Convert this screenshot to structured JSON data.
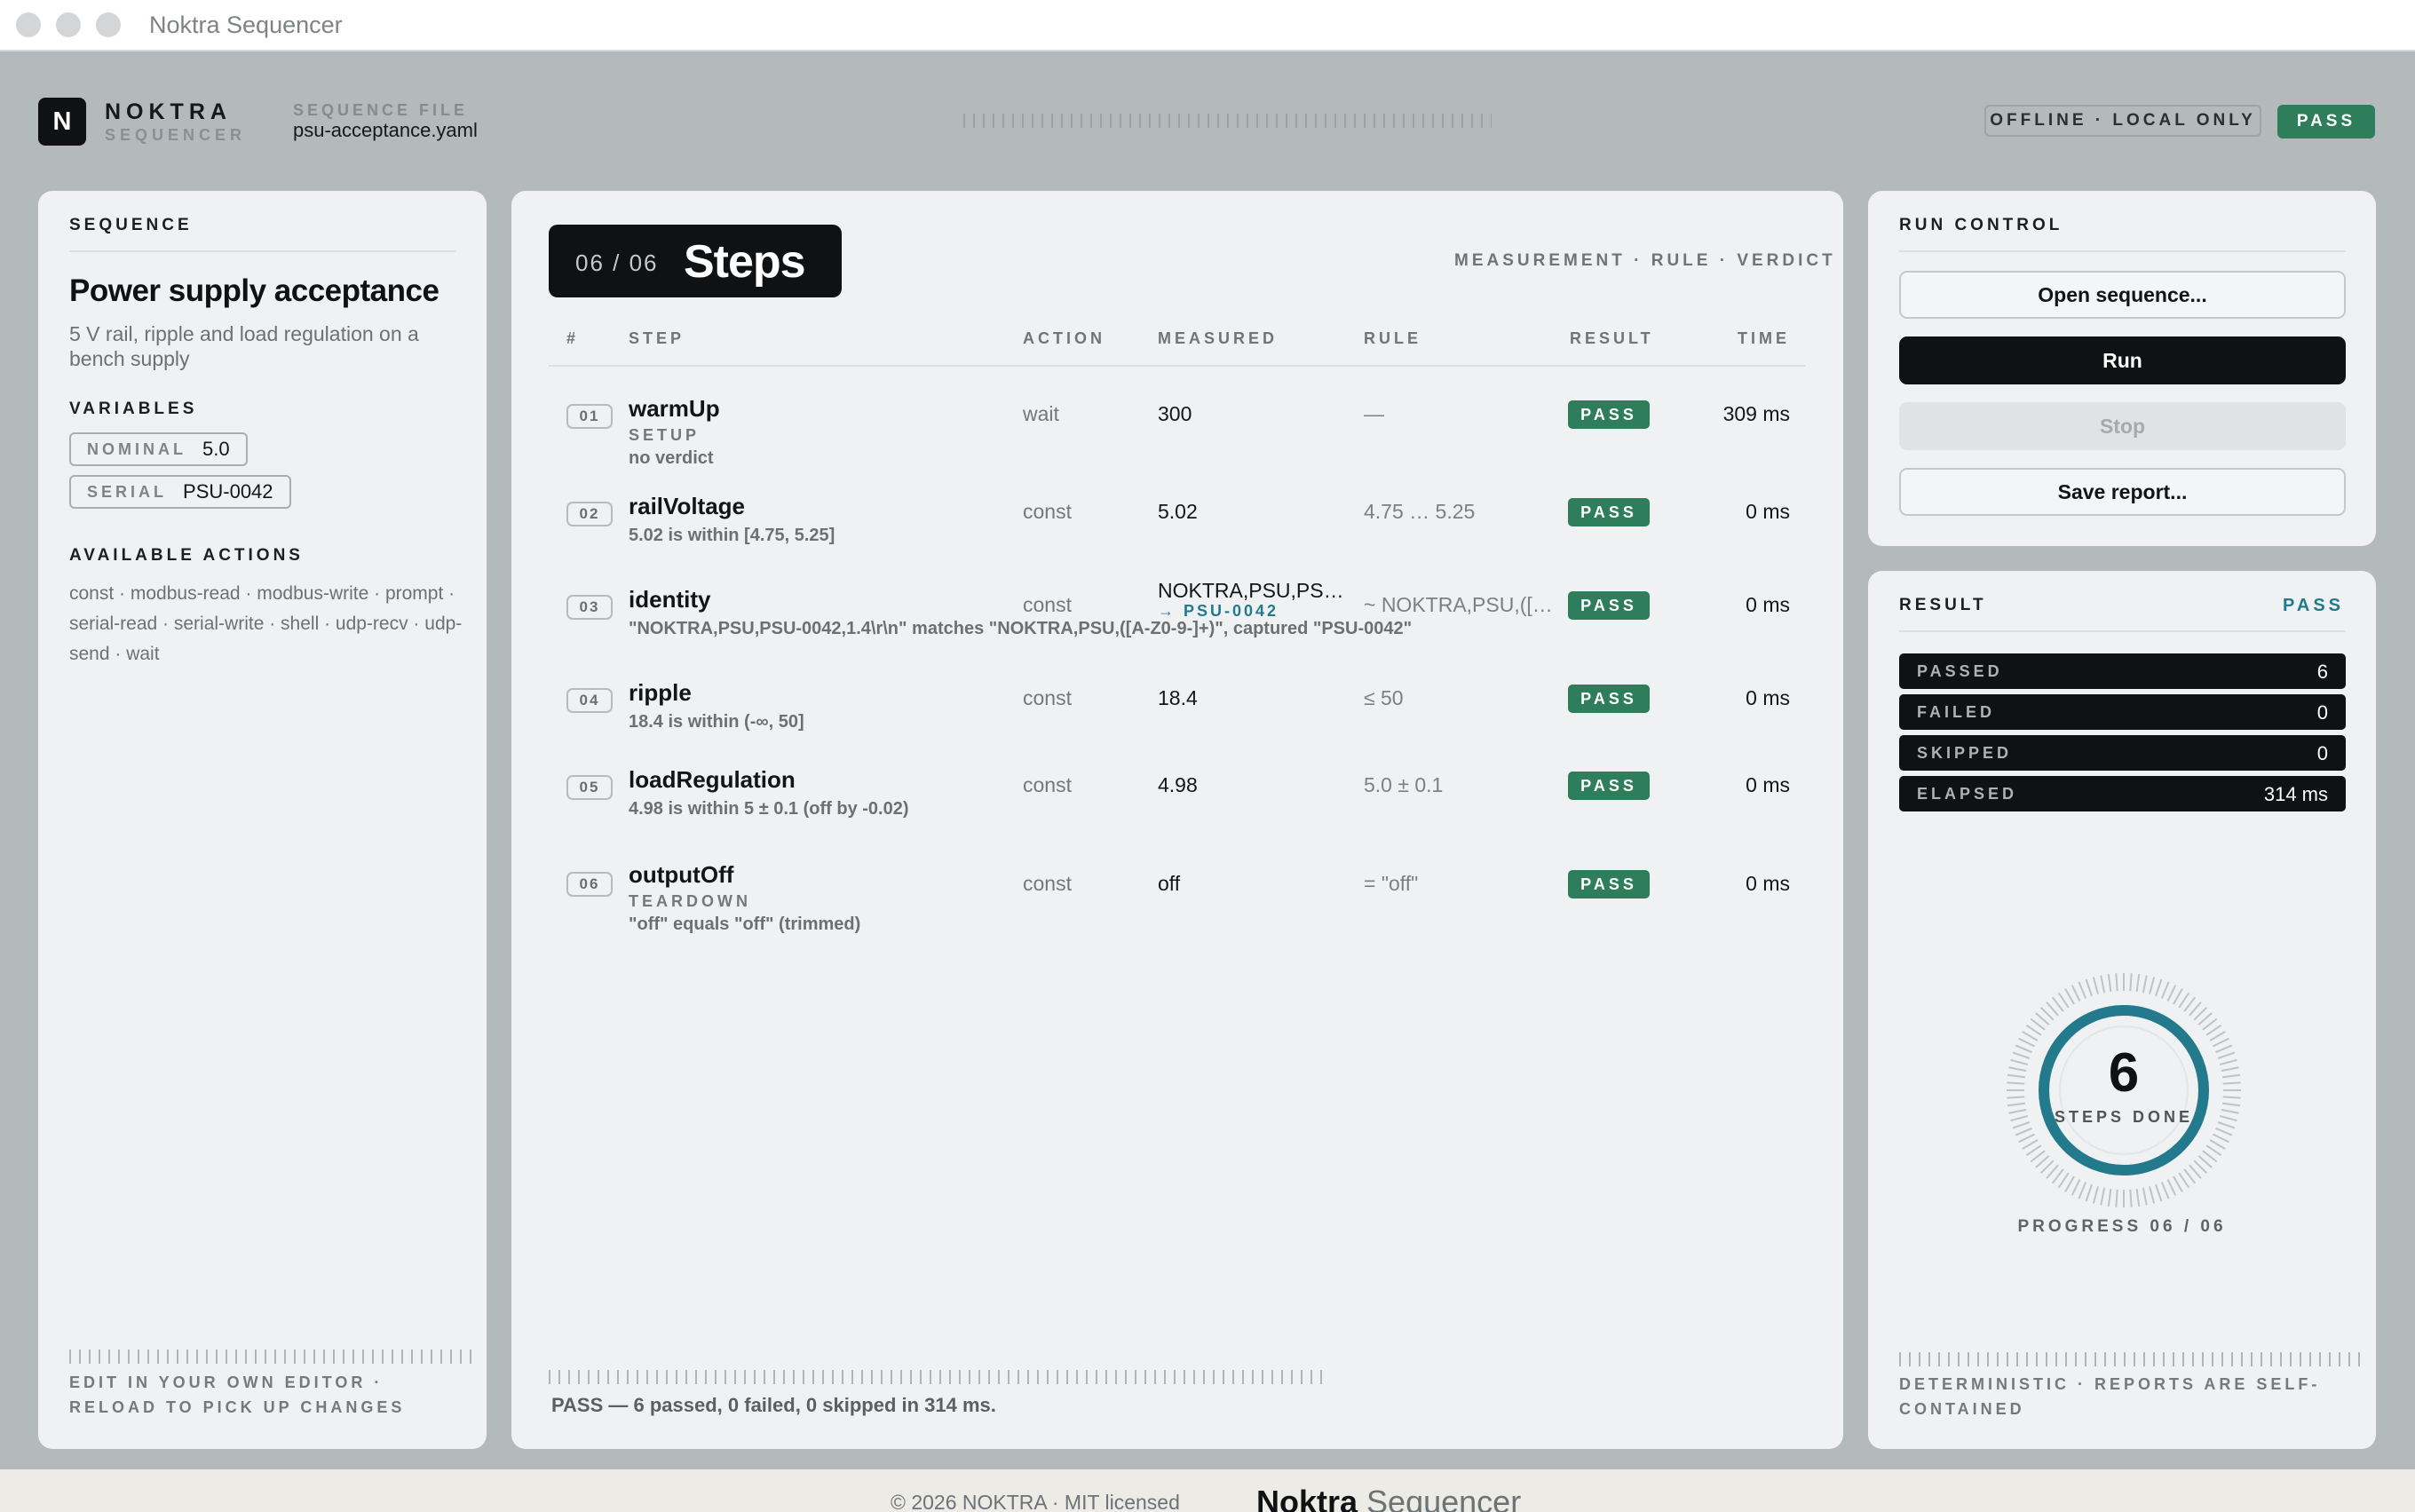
{
  "window": {
    "title": "Noktra Sequencer"
  },
  "header": {
    "logo_letter": "N",
    "brand": "NOKTRA",
    "brand_sub": "SEQUENCER",
    "sequence_file_label": "SEQUENCE FILE",
    "sequence_file": "psu-acceptance.yaml",
    "offline_badge": "OFFLINE · LOCAL ONLY",
    "status_badge": "PASS"
  },
  "sequence": {
    "section_label": "SEQUENCE",
    "title": "Power supply acceptance",
    "description": "5 V rail, ripple and load regulation on a bench supply",
    "variables_label": "VARIABLES",
    "variables": [
      {
        "key": "NOMINAL",
        "value": "5.0"
      },
      {
        "key": "SERIAL",
        "value": "PSU-0042"
      }
    ],
    "actions_label": "AVAILABLE ACTIONS",
    "actions_text": "const · modbus-read · modbus-write · prompt · serial-read · serial-write · shell · udp-recv · udp-send · wait",
    "footer_line1": "EDIT IN YOUR OWN EDITOR ·",
    "footer_line2": "RELOAD TO PICK UP CHANGES"
  },
  "steps_panel": {
    "count": "06 / 06",
    "title": "Steps",
    "subtitle": "MEASUREMENT · RULE · VERDICT",
    "columns": [
      "#",
      "STEP",
      "ACTION",
      "MEASURED",
      "RULE",
      "RESULT",
      "TIME"
    ],
    "steps": [
      {
        "num": "01",
        "name": "warmUp",
        "tag": "SETUP",
        "note": "no verdict",
        "action": "wait",
        "measured": "300",
        "captured": "",
        "rule": "—",
        "result": "PASS",
        "time": "309 ms"
      },
      {
        "num": "02",
        "name": "railVoltage",
        "tag": "",
        "note": "5.02 is within [4.75, 5.25]",
        "action": "const",
        "measured": "5.02",
        "captured": "",
        "rule": "4.75 … 5.25",
        "result": "PASS",
        "time": "0 ms"
      },
      {
        "num": "03",
        "name": "identity",
        "tag": "",
        "note": "\"NOKTRA,PSU,PSU-0042,1.4\\r\\n\" matches \"NOKTRA,PSU,([A-Z0-9-]+)\", captured \"PSU-0042\"",
        "action": "const",
        "measured": "NOKTRA,PSU,PS…",
        "captured": "→ PSU-0042",
        "rule": "~ NOKTRA,PSU,([…",
        "result": "PASS",
        "time": "0 ms"
      },
      {
        "num": "04",
        "name": "ripple",
        "tag": "",
        "note": "18.4 is within (-∞, 50]",
        "action": "const",
        "measured": "18.4",
        "captured": "",
        "rule": "≤ 50",
        "result": "PASS",
        "time": "0 ms"
      },
      {
        "num": "05",
        "name": "loadRegulation",
        "tag": "",
        "note": "4.98 is within 5 ± 0.1 (off by -0.02)",
        "action": "const",
        "measured": "4.98",
        "captured": "",
        "rule": "5.0 ± 0.1",
        "result": "PASS",
        "time": "0 ms"
      },
      {
        "num": "06",
        "name": "outputOff",
        "tag": "TEARDOWN",
        "note": "\"off\" equals \"off\" (trimmed)",
        "action": "const",
        "measured": "off",
        "captured": "",
        "rule": "= \"off\"",
        "result": "PASS",
        "time": "0 ms"
      }
    ],
    "summary": "PASS — 6 passed, 0 failed, 0 skipped in 314 ms."
  },
  "run_control": {
    "section_label": "RUN CONTROL",
    "open_label": "Open sequence...",
    "run_label": "Run",
    "stop_label": "Stop",
    "save_label": "Save report..."
  },
  "result": {
    "section_label": "RESULT",
    "status": "PASS",
    "stats": [
      {
        "key": "PASSED",
        "value": "6"
      },
      {
        "key": "FAILED",
        "value": "0"
      },
      {
        "key": "SKIPPED",
        "value": "0"
      },
      {
        "key": "ELAPSED",
        "value": "314 ms"
      }
    ],
    "dial_value": "6",
    "dial_label": "STEPS DONE",
    "progress_fraction": 1.0,
    "progress_label": "PROGRESS  06 / 06",
    "footer_line1": "DETERMINISTIC · REPORTS ARE SELF-",
    "footer_line2": "CONTAINED"
  },
  "footer": {
    "copyright": "© 2026 NOKTRA  ·  MIT licensed",
    "brand_bold": "Noktra",
    "brand_light": "Sequencer"
  },
  "colors": {
    "pass_green": "#2e7d5b",
    "accent_teal": "#227a8c",
    "ink": "#0f1113"
  }
}
